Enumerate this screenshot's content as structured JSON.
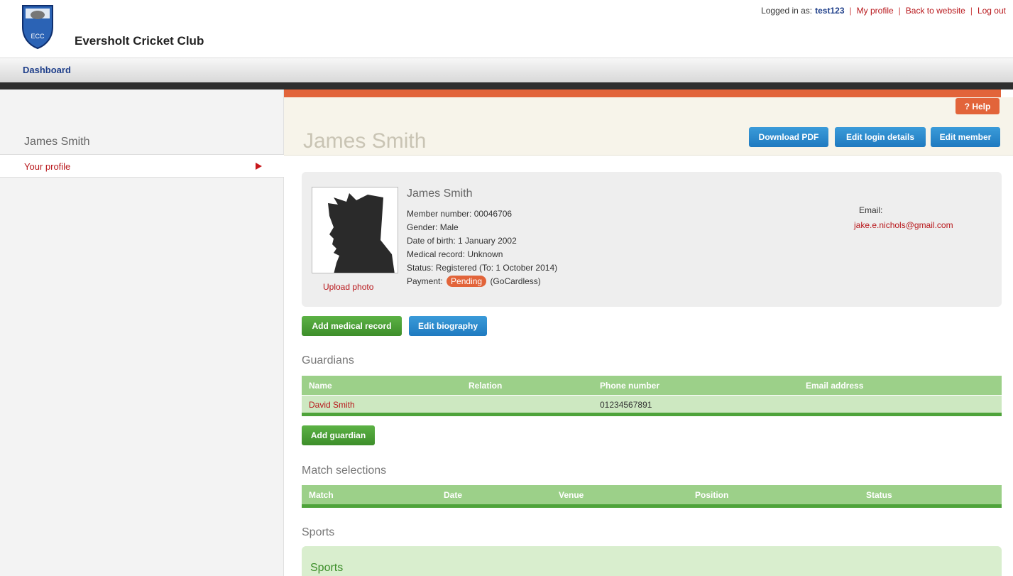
{
  "header": {
    "club_name": "Eversholt Cricket Club",
    "logo_text": "ECC",
    "logged_in_label": "Logged in as:",
    "username": "test123",
    "links": [
      "My profile",
      "Back to website",
      "Log out"
    ]
  },
  "nav": {
    "dashboard": "Dashboard"
  },
  "sidebar": {
    "name": "James Smith",
    "menu": [
      {
        "label": "Your profile"
      }
    ]
  },
  "page": {
    "title": "James Smith",
    "help": "? Help",
    "buttons": {
      "download_pdf": "Download PDF",
      "edit_login": "Edit login details",
      "edit_member": "Edit member"
    }
  },
  "profile": {
    "name": "James Smith",
    "member_number": "Member number: 00046706",
    "gender": "Gender: Male",
    "dob": "Date of birth: 1 January 2002",
    "medical": "Medical record: Unknown",
    "status": "Status: Registered (To: 1 October 2014)",
    "payment_label": "Payment:",
    "payment_badge": "Pending",
    "payment_method": "(GoCardless)",
    "upload_photo": "Upload photo",
    "email_label": "Email:",
    "email": "jake.e.nichols@gmail.com"
  },
  "actions": {
    "add_medical": "Add medical record",
    "edit_bio": "Edit biography",
    "add_guardian": "Add guardian"
  },
  "guardians": {
    "title": "Guardians",
    "columns": [
      "Name",
      "Relation",
      "Phone number",
      "Email address"
    ],
    "rows": [
      {
        "name": "David Smith",
        "relation": "",
        "phone": "01234567891",
        "email": ""
      }
    ]
  },
  "matches": {
    "title": "Match selections",
    "columns": [
      "Match",
      "Date",
      "Venue",
      "Position",
      "Status"
    ]
  },
  "sports": {
    "title": "Sports",
    "box_title": "Sports"
  },
  "colors": {
    "accent_orange": "#e2643a",
    "link_red": "#b8171b",
    "green": "#4ea33a",
    "blue": "#1f7ac0"
  }
}
